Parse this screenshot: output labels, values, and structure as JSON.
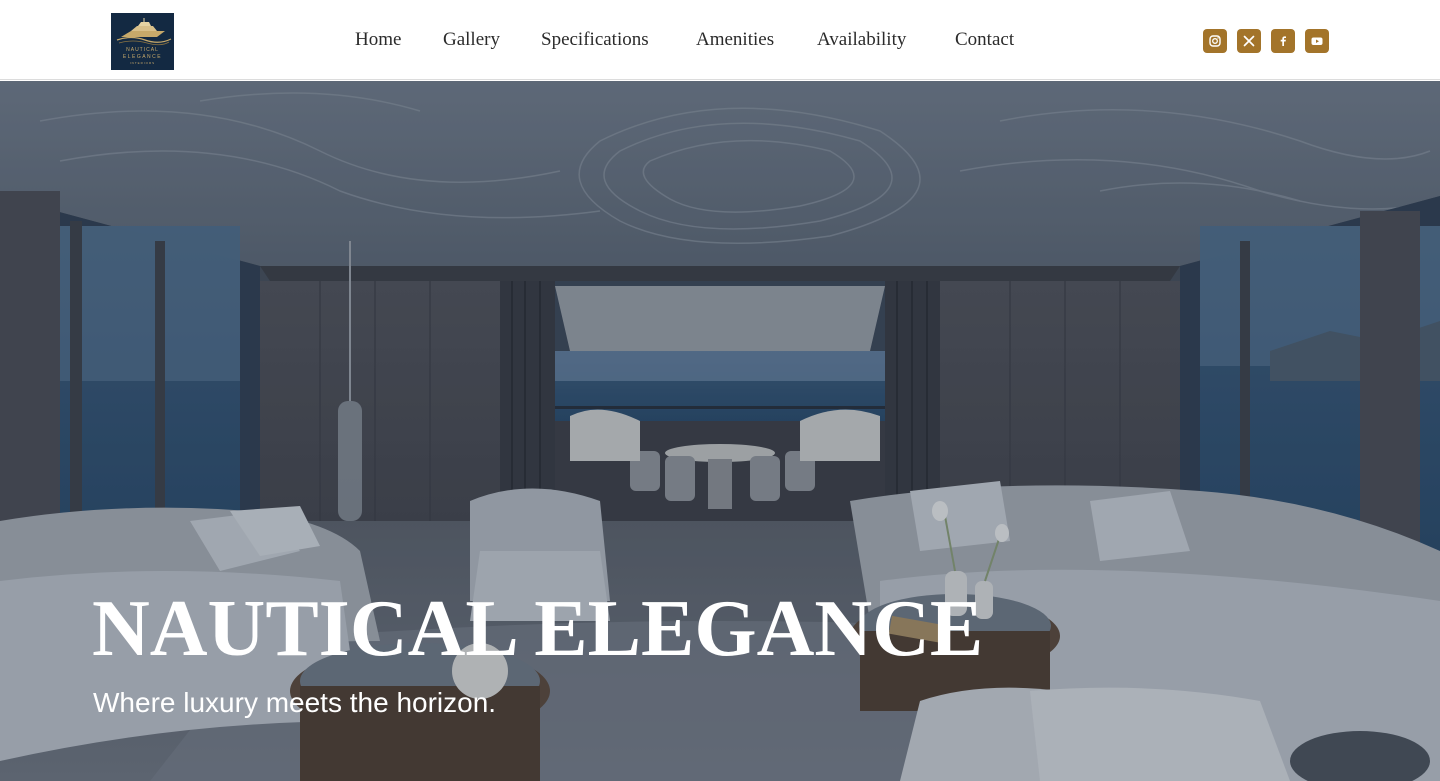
{
  "brand": {
    "logo_line1": "NAUTICAL",
    "logo_line2": "ELEGANCE",
    "logo_line3": "INTERIORS"
  },
  "nav": {
    "items": [
      {
        "label": "Home"
      },
      {
        "label": "Gallery"
      },
      {
        "label": "Specifications"
      },
      {
        "label": "Amenities"
      },
      {
        "label": "Availability"
      },
      {
        "label": "Contact"
      }
    ]
  },
  "socials": {
    "icons": [
      "instagram-icon",
      "x-icon",
      "facebook-icon",
      "youtube-icon"
    ],
    "accent_color": "#a3742a"
  },
  "hero": {
    "title": "NAUTICAL ELEGANCE",
    "subtitle": "Where luxury meets the horizon."
  }
}
